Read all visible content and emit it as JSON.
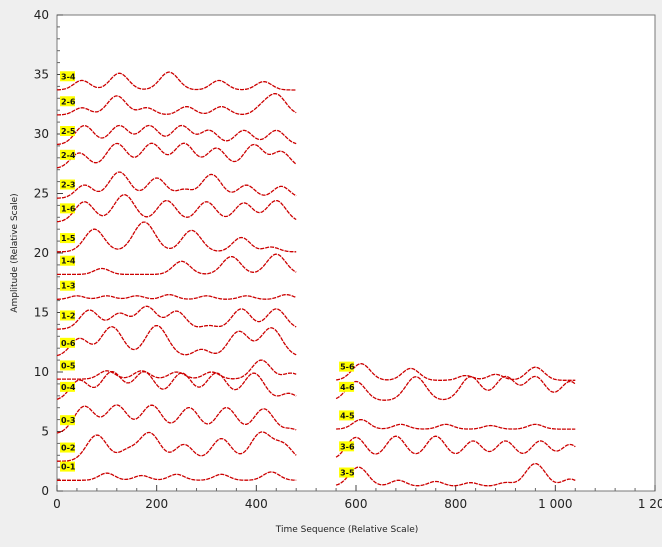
{
  "chart_data": {
    "type": "line",
    "xlabel": "Time Sequence (Relative Scale)",
    "ylabel": "Amplitude (Relative Scale)",
    "xlim": [
      0,
      1200
    ],
    "ylim": [
      0,
      40
    ],
    "x_ticks": [
      0,
      200,
      400,
      600,
      800,
      1000,
      1200
    ],
    "x_tick_labels": [
      "0",
      "200",
      "400",
      "600",
      "800",
      "1 000",
      "1 200"
    ],
    "y_ticks": [
      0,
      5,
      10,
      15,
      20,
      25,
      30,
      35,
      40
    ],
    "y_tick_labels": [
      "0",
      "5",
      "10",
      "15",
      "20",
      "25",
      "30",
      "35",
      "40"
    ],
    "grid": false,
    "line_color": "#cc0000",
    "label_color": "#ffff00",
    "series": [
      {
        "name": "0-1",
        "x_start": 0,
        "x_end": 480,
        "baseline": 0.9,
        "peaks": [
          [
            100,
            0.6
          ],
          [
            170,
            0.4
          ],
          [
            240,
            0.5
          ],
          [
            330,
            0.5
          ],
          [
            430,
            0.7
          ]
        ]
      },
      {
        "name": "0-2",
        "x_start": 0,
        "x_end": 480,
        "baseline": 2.5,
        "peaks": [
          [
            80,
            2.2
          ],
          [
            140,
            0.8
          ],
          [
            185,
            2.4
          ],
          [
            255,
            1.4
          ],
          [
            330,
            1.9
          ],
          [
            410,
            2.4
          ],
          [
            455,
            1.3
          ]
        ]
      },
      {
        "name": "0-3",
        "x_start": 0,
        "x_end": 480,
        "baseline": 4.8,
        "peaks": [
          [
            55,
            2.3
          ],
          [
            120,
            2.4
          ],
          [
            190,
            2.4
          ],
          [
            265,
            2.2
          ],
          [
            340,
            2.2
          ],
          [
            415,
            2.1
          ],
          [
            470,
            0.4
          ]
        ]
      },
      {
        "name": "0-4",
        "x_start": 0,
        "x_end": 480,
        "baseline": 7.6,
        "peaks": [
          [
            45,
            1.7
          ],
          [
            110,
            2.4
          ],
          [
            175,
            2.4
          ],
          [
            250,
            2.3
          ],
          [
            320,
            2.3
          ],
          [
            395,
            2.3
          ],
          [
            465,
            0.6
          ]
        ]
      },
      {
        "name": "0-5",
        "x_start": 0,
        "x_end": 480,
        "baseline": 9.4,
        "peaks": [
          [
            100,
            0.7
          ],
          [
            170,
            0.7
          ],
          [
            240,
            0.6
          ],
          [
            310,
            0.6
          ],
          [
            410,
            1.6
          ],
          [
            470,
            0.5
          ]
        ]
      },
      {
        "name": "0-6",
        "x_start": 0,
        "x_end": 480,
        "baseline": 11.3,
        "peaks": [
          [
            45,
            1.5
          ],
          [
            110,
            2.5
          ],
          [
            200,
            2.6
          ],
          [
            290,
            0.6
          ],
          [
            365,
            2.1
          ],
          [
            430,
            2.4
          ]
        ]
      },
      {
        "name": "1-2",
        "x_start": 0,
        "x_end": 480,
        "baseline": 13.6,
        "peaks": [
          [
            65,
            1.6
          ],
          [
            125,
            1.3
          ],
          [
            180,
            1.9
          ],
          [
            240,
            1.5
          ],
          [
            305,
            0.3
          ],
          [
            370,
            1.7
          ],
          [
            440,
            1.7
          ]
        ]
      },
      {
        "name": "1-3",
        "x_start": 0,
        "x_end": 480,
        "baseline": 16.1,
        "peaks": [
          [
            40,
            0.3
          ],
          [
            100,
            0.3
          ],
          [
            160,
            0.3
          ],
          [
            225,
            0.4
          ],
          [
            300,
            0.3
          ],
          [
            380,
            0.3
          ],
          [
            460,
            0.4
          ]
        ]
      },
      {
        "name": "1-4",
        "x_start": 0,
        "x_end": 480,
        "baseline": 18.2,
        "peaks": [
          [
            90,
            0.5
          ],
          [
            250,
            1.1
          ],
          [
            350,
            1.5
          ],
          [
            440,
            1.7
          ]
        ]
      },
      {
        "name": "1-5",
        "x_start": 0,
        "x_end": 480,
        "baseline": 20.1,
        "peaks": [
          [
            75,
            1.9
          ],
          [
            175,
            2.5
          ],
          [
            270,
            1.8
          ],
          [
            370,
            1.2
          ],
          [
            430,
            0.4
          ]
        ]
      },
      {
        "name": "1-6",
        "x_start": 0,
        "x_end": 480,
        "baseline": 22.6,
        "peaks": [
          [
            55,
            1.7
          ],
          [
            135,
            2.3
          ],
          [
            220,
            1.8
          ],
          [
            300,
            1.7
          ],
          [
            375,
            1.6
          ],
          [
            440,
            1.8
          ]
        ]
      },
      {
        "name": "2-3",
        "x_start": 0,
        "x_end": 480,
        "baseline": 24.6,
        "peaks": [
          [
            55,
            1.1
          ],
          [
            125,
            2.2
          ],
          [
            200,
            1.7
          ],
          [
            255,
            0.7
          ],
          [
            310,
            2.0
          ],
          [
            380,
            1.1
          ],
          [
            450,
            1.0
          ]
        ]
      },
      {
        "name": "2-4",
        "x_start": 0,
        "x_end": 480,
        "baseline": 27.1,
        "peaks": [
          [
            45,
            1.3
          ],
          [
            120,
            2.1
          ],
          [
            190,
            2.1
          ],
          [
            255,
            2.1
          ],
          [
            320,
            1.7
          ],
          [
            395,
            2.0
          ],
          [
            450,
            1.4
          ]
        ]
      },
      {
        "name": "2-5",
        "x_start": 0,
        "x_end": 480,
        "baseline": 29.1,
        "peaks": [
          [
            55,
            1.6
          ],
          [
            125,
            1.6
          ],
          [
            185,
            1.6
          ],
          [
            250,
            1.6
          ],
          [
            305,
            1.2
          ],
          [
            375,
            1.2
          ],
          [
            440,
            1.2
          ]
        ]
      },
      {
        "name": "2-6",
        "x_start": 0,
        "x_end": 480,
        "baseline": 31.6,
        "peaks": [
          [
            50,
            0.6
          ],
          [
            120,
            1.6
          ],
          [
            180,
            0.6
          ],
          [
            260,
            0.7
          ],
          [
            330,
            0.7
          ],
          [
            410,
            0.5
          ],
          [
            440,
            1.7
          ]
        ]
      },
      {
        "name": "3-4",
        "x_start": 0,
        "x_end": 480,
        "baseline": 33.7,
        "peaks": [
          [
            50,
            0.8
          ],
          [
            125,
            1.4
          ],
          [
            225,
            1.5
          ],
          [
            325,
            0.8
          ],
          [
            415,
            0.7
          ]
        ]
      },
      {
        "name": "3-5",
        "x_start": 560,
        "x_end": 1040,
        "baseline": 0.4,
        "peaks": [
          [
            605,
            1.6
          ],
          [
            685,
            0.5
          ],
          [
            760,
            0.4
          ],
          [
            830,
            0.3
          ],
          [
            900,
            0.3
          ],
          [
            960,
            1.9
          ],
          [
            1030,
            0.6
          ]
        ]
      },
      {
        "name": "3-6",
        "x_start": 560,
        "x_end": 1040,
        "baseline": 2.6,
        "peaks": [
          [
            600,
            1.9
          ],
          [
            680,
            2.0
          ],
          [
            760,
            2.0
          ],
          [
            835,
            1.6
          ],
          [
            900,
            1.6
          ],
          [
            970,
            1.6
          ],
          [
            1030,
            1.3
          ]
        ]
      },
      {
        "name": "4-5",
        "x_start": 560,
        "x_end": 1040,
        "baseline": 5.2,
        "peaks": [
          [
            610,
            0.8
          ],
          [
            690,
            0.4
          ],
          [
            780,
            0.4
          ],
          [
            870,
            0.3
          ],
          [
            960,
            0.4
          ]
        ]
      },
      {
        "name": "4-6",
        "x_start": 560,
        "x_end": 1040,
        "baseline": 7.6,
        "peaks": [
          [
            600,
            1.6
          ],
          [
            720,
            2.0
          ],
          [
            830,
            2.0
          ],
          [
            900,
            2.0
          ],
          [
            960,
            2.0
          ],
          [
            1030,
            1.6
          ]
        ]
      },
      {
        "name": "5-6",
        "x_start": 560,
        "x_end": 1040,
        "baseline": 9.3,
        "peaks": [
          [
            610,
            1.4
          ],
          [
            710,
            1.0
          ],
          [
            820,
            0.4
          ],
          [
            880,
            0.5
          ],
          [
            960,
            1.1
          ]
        ]
      }
    ]
  }
}
